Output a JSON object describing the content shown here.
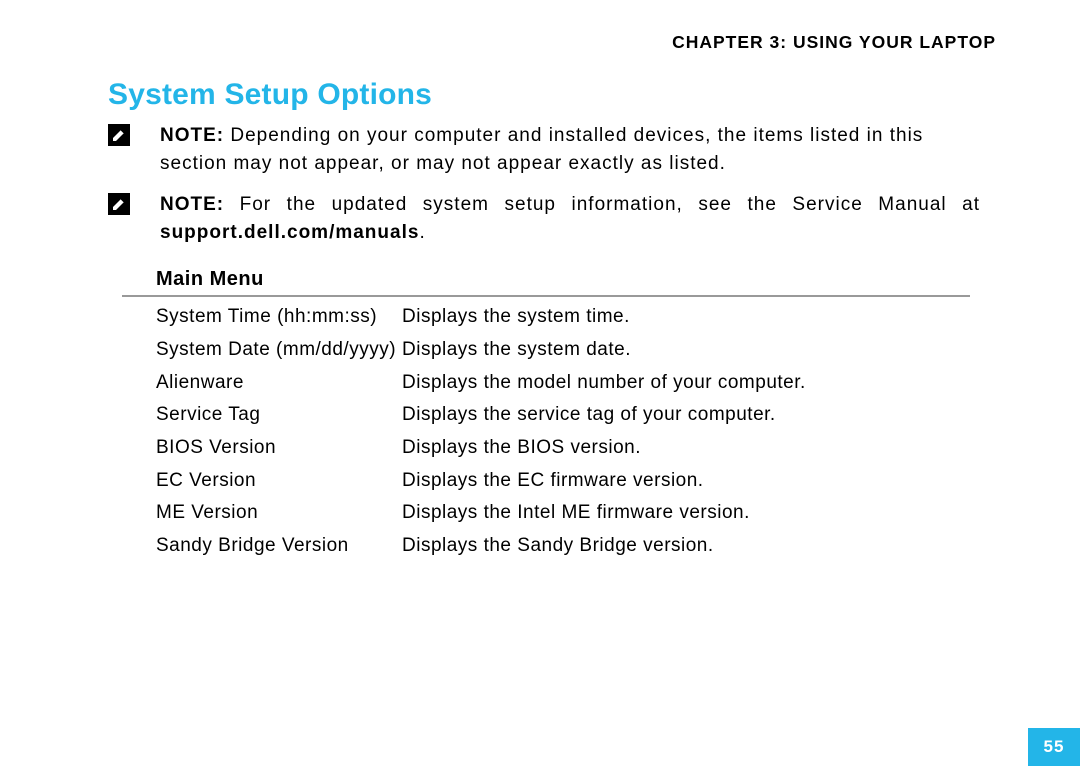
{
  "chapter_header": "CHAPTER 3: USING YOUR LAPTOP",
  "section_title": "System Setup Options",
  "notes": [
    {
      "label": "NOTE:",
      "text": " Depending on your computer and installed devices, the items listed in this section may not appear, or may not appear exactly as listed."
    },
    {
      "label": "NOTE:",
      "text_prefix": " For the updated system setup information, see the Service Manual at ",
      "bold": "support.dell.com/manuals",
      "suffix": "."
    }
  ],
  "menu_title": "Main Menu",
  "options": [
    {
      "name": "System Time (hh:mm:ss)",
      "desc": "Displays the system time."
    },
    {
      "name": "System Date (mm/dd/yyyy)",
      "desc": "Displays the system date."
    },
    {
      "name": "Alienware",
      "desc": "Displays the model number of your computer."
    },
    {
      "name": "Service Tag",
      "desc": "Displays the service tag of your computer."
    },
    {
      "name": "BIOS Version",
      "desc": "Displays the BIOS version."
    },
    {
      "name": "EC Version",
      "desc": "Displays the EC firmware version."
    },
    {
      "name": "ME Version",
      "desc": "Displays the Intel ME firmware version."
    },
    {
      "name": "Sandy Bridge Version",
      "desc": "Displays the Sandy Bridge version."
    }
  ],
  "page_number": "55"
}
